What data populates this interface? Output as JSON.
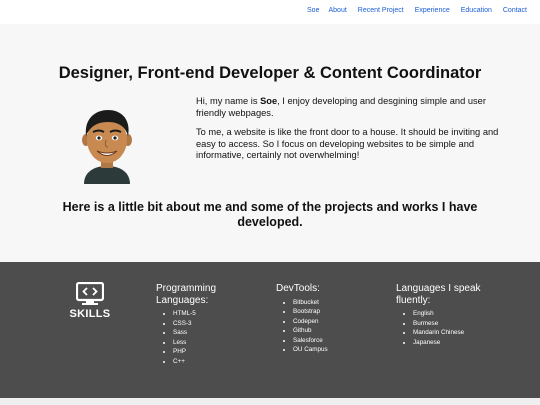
{
  "nav": {
    "brand": "Soe",
    "items": [
      "About",
      "Recent Project",
      "Experience",
      "Education",
      "Contact"
    ]
  },
  "hero": {
    "title": "Designer, Front-end Developer & Content Coordinator",
    "intro_prefix": "Hi, my name is ",
    "intro_name": "Soe",
    "intro_suffix": ", I enjoy developing and desgining simple and user friendly webpages.",
    "paragraph2": "To me, a website is like the front door to a house. It should be inviting and easy to access. So I focus on developing websites to be simple and informative, certainly not overwhelming!",
    "subtitle": "Here is a little bit about me and some of the projects and works I have developed."
  },
  "skills": {
    "label": "SKILLS",
    "columns": [
      {
        "heading": "Programming Languages:",
        "items": [
          "HTML-5",
          "CSS-3",
          "Sass",
          "Less",
          "PHP",
          "C++"
        ]
      },
      {
        "heading": "DevTools:",
        "items": [
          "Bitbucket",
          "Bootstrap",
          "Codepen",
          "Github",
          "Salesforce",
          "OU Campus"
        ]
      },
      {
        "heading": "Languages I speak fluently:",
        "items": [
          "English",
          "Burmese",
          "Mandarin Chinese",
          "Japanese"
        ]
      }
    ]
  },
  "colors": {
    "link": "#1a5fd6",
    "hero_bg": "#f7f7f7",
    "skills_bg": "#4d4d4d"
  }
}
